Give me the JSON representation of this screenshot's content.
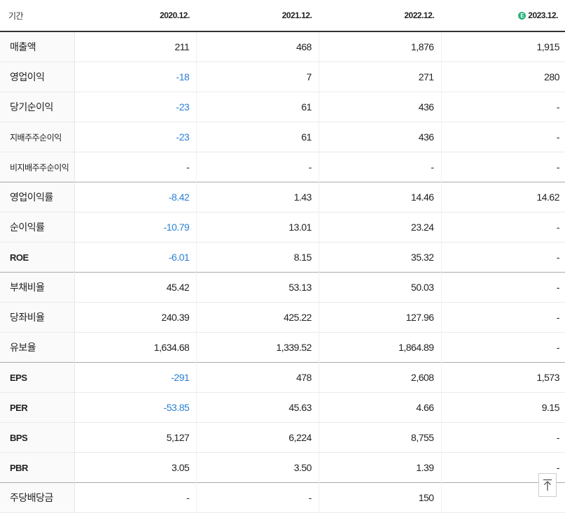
{
  "header": {
    "label": "기간",
    "periods": [
      "2020.12.",
      "2021.12.",
      "2022.12.",
      "2023.12."
    ],
    "estimate_badge": "E"
  },
  "colors": {
    "negative": "#2a7fd4",
    "estimate_badge": "#27b37a"
  },
  "rows": [
    {
      "label": "매출액",
      "values": [
        "211",
        "468",
        "1,876",
        "1,915"
      ]
    },
    {
      "label": "영업이익",
      "values": [
        "-18",
        "7",
        "271",
        "280"
      ]
    },
    {
      "label": "당기순이익",
      "values": [
        "-23",
        "61",
        "436",
        "-"
      ]
    },
    {
      "label": "지배주주순이익",
      "values": [
        "-23",
        "61",
        "436",
        "-"
      ]
    },
    {
      "label": "비지배주주순이익",
      "values": [
        "-",
        "-",
        "-",
        "-"
      ]
    },
    {
      "label": "영업이익률",
      "values": [
        "-8.42",
        "1.43",
        "14.46",
        "14.62"
      ]
    },
    {
      "label": "순이익률",
      "values": [
        "-10.79",
        "13.01",
        "23.24",
        "-"
      ]
    },
    {
      "label": "ROE",
      "values": [
        "-6.01",
        "8.15",
        "35.32",
        "-"
      ]
    },
    {
      "label": "부채비율",
      "values": [
        "45.42",
        "53.13",
        "50.03",
        "-"
      ]
    },
    {
      "label": "당좌비율",
      "values": [
        "240.39",
        "425.22",
        "127.96",
        "-"
      ]
    },
    {
      "label": "유보율",
      "values": [
        "1,634.68",
        "1,339.52",
        "1,864.89",
        "-"
      ]
    },
    {
      "label": "EPS",
      "values": [
        "-291",
        "478",
        "2,608",
        "1,573"
      ]
    },
    {
      "label": "PER",
      "values": [
        "-53.85",
        "45.63",
        "4.66",
        "9.15"
      ]
    },
    {
      "label": "BPS",
      "values": [
        "5,127",
        "6,224",
        "8,755",
        "-"
      ]
    },
    {
      "label": "PBR",
      "values": [
        "3.05",
        "3.50",
        "1.39",
        "-"
      ]
    },
    {
      "label": "주당배당금",
      "values": [
        "-",
        "-",
        "150",
        ""
      ]
    }
  ],
  "scroll_top_icon": "arrow-up-to-top-icon"
}
